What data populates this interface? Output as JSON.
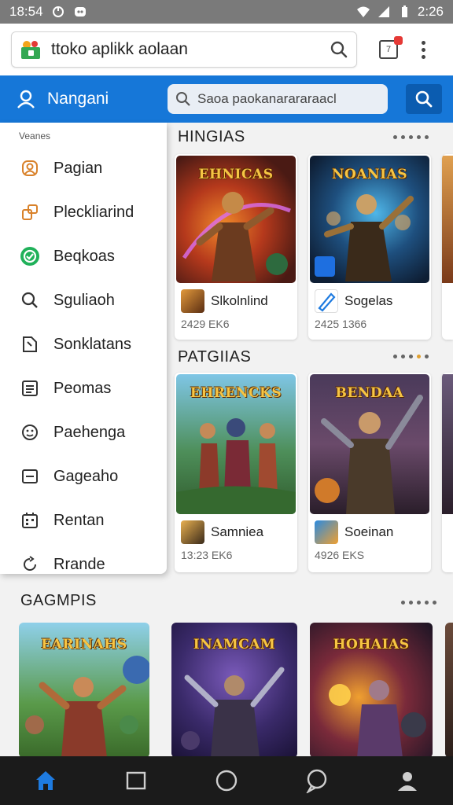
{
  "status_bar": {
    "time_left": "18:54",
    "time_right": "2:26",
    "icons": [
      "notification-icon",
      "app-icon",
      "wifi-icon",
      "signal-icon",
      "battery-icon"
    ]
  },
  "browser": {
    "url": "ttoko aplikk aolaan",
    "tab_count": "7"
  },
  "header": {
    "nav_label": "Nangani",
    "search_placeholder": "Saoa paokanarararaacl"
  },
  "drawer": {
    "caption": "Veanes",
    "items": [
      {
        "label": "Pagian",
        "icon": "person-icon"
      },
      {
        "label": "Pleckliarind",
        "icon": "link-icon"
      },
      {
        "label": "Beqkoas",
        "icon": "check-badge-icon"
      },
      {
        "label": "Sguliaoh",
        "icon": "search-icon"
      },
      {
        "label": "Sonklatans",
        "icon": "document-icon"
      },
      {
        "label": "Peomas",
        "icon": "list-icon"
      },
      {
        "label": "Paehenga",
        "icon": "smile-icon"
      },
      {
        "label": "Gageaho",
        "icon": "minus-box-icon"
      },
      {
        "label": "Rentan",
        "icon": "grid-icon"
      },
      {
        "label": "Rrande",
        "icon": "refresh-icon"
      }
    ]
  },
  "sections": [
    {
      "title": "HINGIAS",
      "cards": [
        {
          "art_title": "EHNICAS",
          "name": "Slkolnlind",
          "meta": "2429 EK6"
        },
        {
          "art_title": "NOANIAS",
          "name": "Sogelas",
          "meta": "2425 1366"
        }
      ]
    },
    {
      "title": "PATGIIAS",
      "cards": [
        {
          "art_title": "EHRENCKS",
          "name": "Samniea",
          "meta": "13:23 EK6"
        },
        {
          "art_title": "BENDAA",
          "name": "Soeinan",
          "meta": "4926 EKS"
        }
      ]
    },
    {
      "title": "GAGMPIS",
      "cards": [
        {
          "art_title": "EARINAHS"
        },
        {
          "art_title": "INAMCAM"
        },
        {
          "art_title": "HOHAIAS"
        }
      ]
    }
  ],
  "bottom_nav": [
    "home-icon",
    "square-icon",
    "circle-icon",
    "chat-icon",
    "profile-icon"
  ],
  "colors": {
    "header_blue": "#1677d8",
    "search_button": "#0b5cb0",
    "nav_bg": "#1b1b1b",
    "active_nav": "#1e7be0"
  }
}
